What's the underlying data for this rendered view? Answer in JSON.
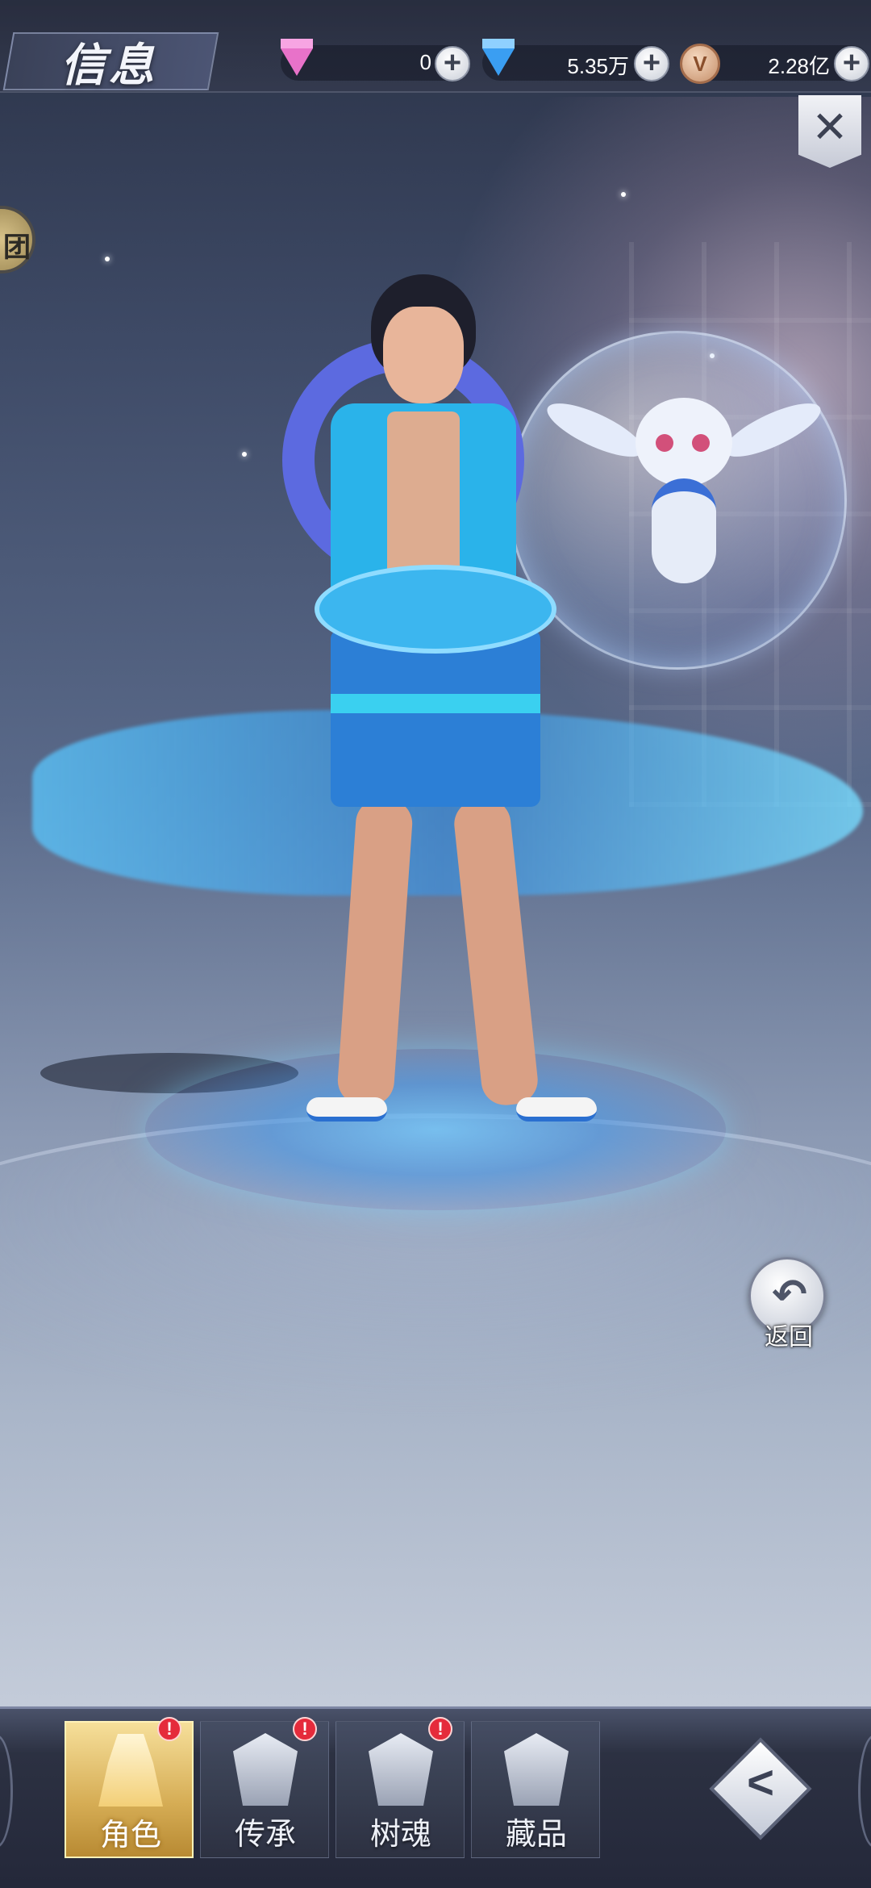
{
  "header": {
    "title": "信息",
    "currencies": [
      {
        "icon": "pink-diamond-icon",
        "value": "0"
      },
      {
        "icon": "blue-diamond-icon",
        "value": "5.35万"
      },
      {
        "icon": "coin-icon",
        "value": "2.28亿",
        "coin_letter": "V"
      }
    ],
    "plus_symbol": "+"
  },
  "close_button": {
    "symbol": "✕"
  },
  "side_badge": {
    "label": "团"
  },
  "return_button": {
    "symbol": "↶",
    "label": "返回"
  },
  "bottom_nav": {
    "tabs": [
      {
        "label": "角色",
        "icon": "character-icon",
        "active": true,
        "alert": true
      },
      {
        "label": "传承",
        "icon": "armor-icon",
        "active": false,
        "alert": true
      },
      {
        "label": "树魂",
        "icon": "tree-soul-icon",
        "active": false,
        "alert": true
      },
      {
        "label": "藏品",
        "icon": "collection-icon",
        "active": false,
        "alert": false
      }
    ],
    "alert_symbol": "!",
    "right_button": {
      "icon": "diamond-arrow-icon",
      "symbol": "<"
    }
  },
  "colors": {
    "accent_gold": "#d6ad55",
    "alert_red": "#e52b3b",
    "water_blue": "#3cb6ef"
  }
}
